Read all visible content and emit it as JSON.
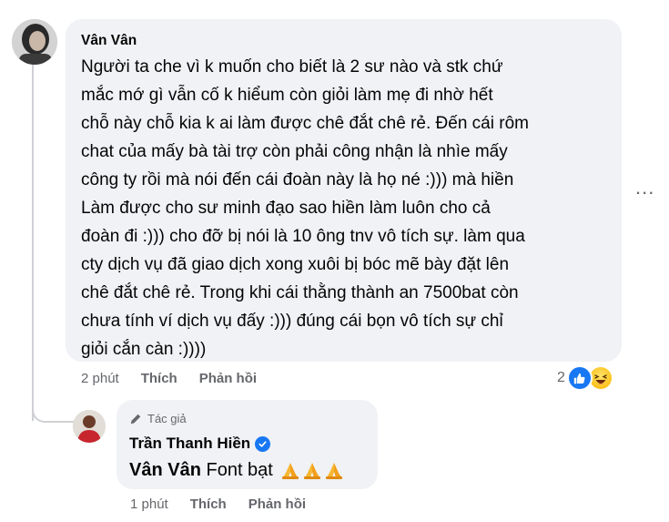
{
  "comment": {
    "author": "Vân Vân",
    "lines": [
      "Người ta che vì k muốn cho biết là 2 sư nào và stk chứ",
      "mắc mớ gì vẫn cố k hiểum còn giỏi làm mẹ đi nhờ hết",
      "chỗ này chỗ kia k ai làm được chê đắt chê rẻ. Đến cái rôm",
      "chat của mấy bà tài trợ còn phải công nhận là nhìe mấy",
      "công ty rồi mà nói đến cái đoàn này là họ né :))) mà hiền",
      "Làm được cho sư minh đạo sao hiền làm luôn cho cả",
      "đoàn đi :))) cho đỡ bị nói là 10 ông tnv vô tích sự. làm qua",
      "cty dịch vụ đã giao dịch xong xuôi bị bóc mẽ bày đặt lên",
      "chê đắt chê rẻ. Trong khi cái thằng thành an 7500bat còn",
      "chưa tính ví dịch vụ đấy :))) đúng cái bọn vô tích sự chỉ",
      "giỏi cắn càn :))))"
    ],
    "time": "2 phút",
    "like_label": "Thích",
    "reply_label": "Phản hồi",
    "reaction_count": "2",
    "more_label": "..."
  },
  "reply": {
    "badge_label": "Tác giả",
    "author": "Trần Thanh Hiền",
    "mention": "Vân Vân",
    "text": "Font bạt",
    "time": "1 phút",
    "like_label": "Thích",
    "reply_label": "Phản hồi"
  },
  "colors": {
    "bubble": "#f0f2f5",
    "meta_text": "#65676b",
    "like_blue": "#1877f2",
    "thread_line": "#ced0d4"
  },
  "icons": [
    "like-reaction-icon",
    "haha-reaction-icon",
    "pencil-icon",
    "verified-badge-icon",
    "folded-hands-emoji",
    "more-options-icon"
  ]
}
